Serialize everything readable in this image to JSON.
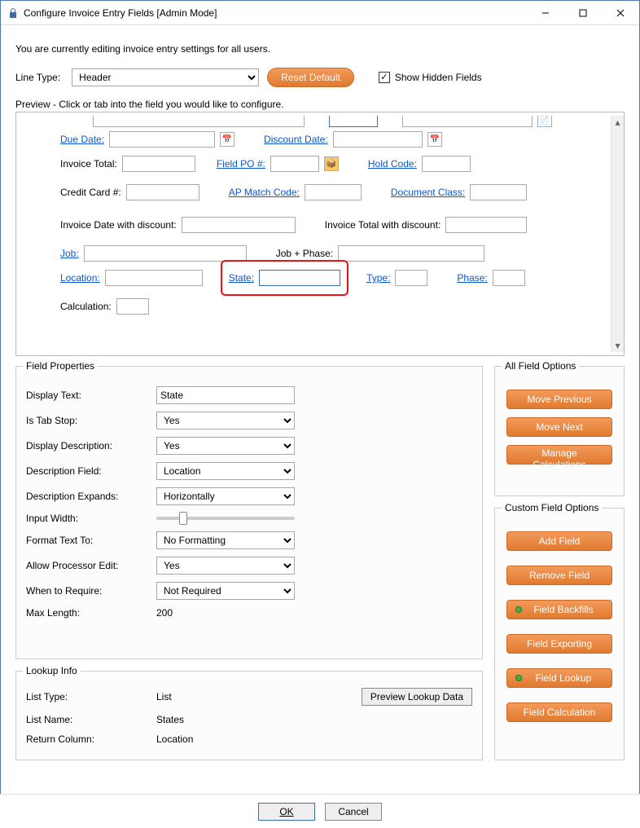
{
  "window": {
    "title": "Configure Invoice Entry Fields [Admin Mode]",
    "subtitle": "You are currently editing invoice entry settings for all users."
  },
  "top": {
    "line_type_label": "Line Type:",
    "line_type_value": "Header",
    "reset_label": "Reset Default",
    "show_hidden_label": "Show Hidden Fields"
  },
  "preview": {
    "heading": "Preview - Click or tab into the field you would like to configure.",
    "fields": {
      "due_date": "Due Date:",
      "discount_date": "Discount Date:",
      "invoice_total": "Invoice Total:",
      "field_po": "Field PO #:",
      "hold_code": "Hold Code:",
      "credit_card": "Credit Card #:",
      "ap_match": "AP Match Code:",
      "document_class": "Document Class:",
      "inv_date_disc": "Invoice Date with discount:",
      "inv_total_disc": "Invoice Total with discount:",
      "job": "Job:",
      "job_phase": "Job + Phase:",
      "location": "Location:",
      "state": "State:",
      "type": "Type:",
      "phase": "Phase:",
      "calculation": "Calculation:"
    }
  },
  "field_props": {
    "title": "Field Properties",
    "display_text_label": "Display Text:",
    "display_text_value": "State",
    "tab_stop_label": "Is Tab Stop:",
    "tab_stop_value": "Yes",
    "display_desc_label": "Display Description:",
    "display_desc_value": "Yes",
    "desc_field_label": "Description Field:",
    "desc_field_value": "Location",
    "desc_expands_label": "Description Expands:",
    "desc_expands_value": "Horizontally",
    "input_width_label": "Input Width:",
    "format_label": "Format Text To:",
    "format_value": "No Formatting",
    "allow_edit_label": "Allow Processor Edit:",
    "allow_edit_value": "Yes",
    "when_require_label": "When to Require:",
    "when_require_value": "Not Required",
    "max_length_label": "Max Length:",
    "max_length_value": "200"
  },
  "lookup": {
    "title": "Lookup Info",
    "list_type_label": "List Type:",
    "list_type_value": "List",
    "list_name_label": "List Name:",
    "list_name_value": "States",
    "return_col_label": "Return Column:",
    "return_col_value": "Location",
    "preview_btn": "Preview Lookup Data"
  },
  "all_opts": {
    "title": "All Field Options",
    "move_prev": "Move Previous",
    "move_next": "Move Next",
    "manage_calc": "Manage Calculations"
  },
  "custom_opts": {
    "title": "Custom Field Options",
    "add_field": "Add Field",
    "remove_field": "Remove Field",
    "backfills": "Field Backfills",
    "exporting": "Field Exporting",
    "lookup": "Field Lookup",
    "calc": "Field Calculation"
  },
  "footer": {
    "ok": "OK",
    "cancel": "Cancel"
  }
}
